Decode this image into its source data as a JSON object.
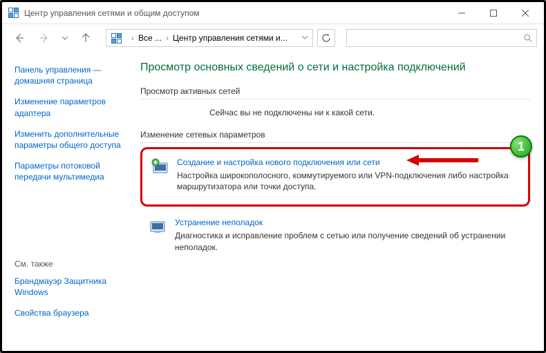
{
  "window": {
    "title": "Центр управления сетями и общим доступом"
  },
  "breadcrumb": {
    "root": "Все ...",
    "current": "Центр управления сетями и..."
  },
  "search": {
    "placeholder": ""
  },
  "sidebar": {
    "links": [
      "Панель управления — домашняя страница",
      "Изменение параметров адаптера",
      "Изменить дополнительные параметры общего доступа",
      "Параметры потоковой передачи мультимедиа"
    ],
    "see_also_label": "См. также",
    "foot_links": [
      "Брандмауэр Защитника Windows",
      "Свойства браузера"
    ]
  },
  "main": {
    "heading": "Просмотр основных сведений о сети и настройка подключений",
    "active_nets_label": "Просмотр активных сетей",
    "no_net_text": "Сейчас вы не подключены ни к какой сети.",
    "change_params_label": "Изменение сетевых параметров",
    "opt1": {
      "title": "Создание и настройка нового подключения или сети",
      "desc": "Настройка широкополосного, коммутируемого или VPN-подключения либо настройка маршрутизатора или точки доступа."
    },
    "opt2": {
      "title": "Устранение неполадок",
      "desc": "Диагностика и исправление проблем с сетью или получение сведений об устранении неполадок."
    }
  },
  "annotation": {
    "badge": "1"
  }
}
